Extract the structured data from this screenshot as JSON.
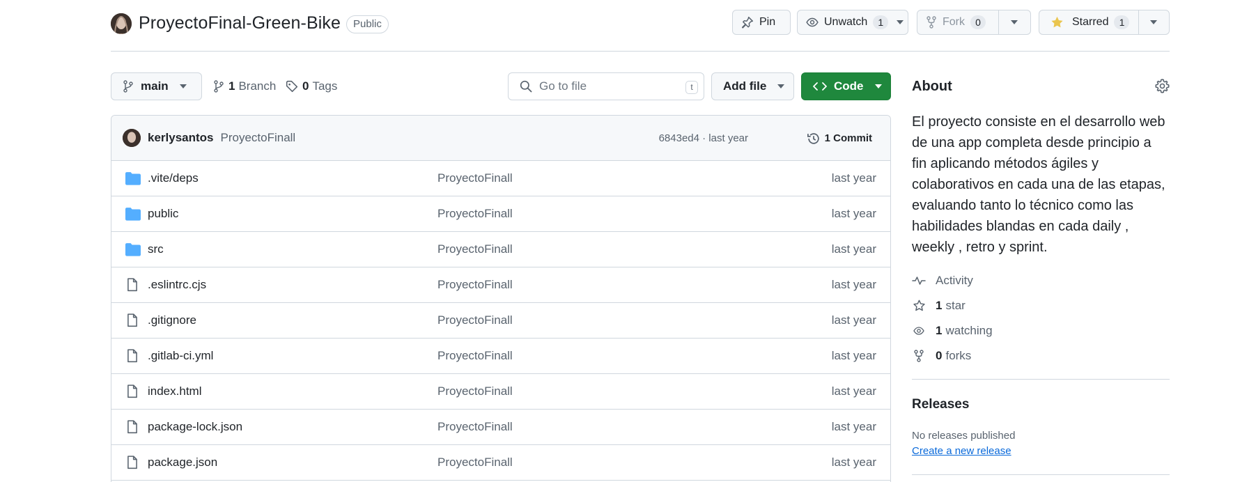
{
  "header": {
    "repo_name": "ProyectoFinal-Green-Bike",
    "visibility": "Public",
    "pin_label": "Pin",
    "watch_label": "Unwatch",
    "watch_count": "1",
    "fork_label": "Fork",
    "fork_count": "0",
    "star_label": "Starred",
    "star_count": "1"
  },
  "toolbar": {
    "branch": "main",
    "branch_count": "1",
    "branch_label": "Branch",
    "tag_count": "0",
    "tag_label": "Tags",
    "search_placeholder": "Go to file",
    "search_shortcut": "t",
    "add_file_label": "Add file",
    "code_label": "Code"
  },
  "commit": {
    "author": "kerlysantos",
    "message": "ProyectoFinall",
    "hash_age": "6843ed4 · last year",
    "count_label": "1 Commit"
  },
  "files": [
    {
      "name": ".vite/deps",
      "type": "folder",
      "message": "ProyectoFinall",
      "age": "last year"
    },
    {
      "name": "public",
      "type": "folder",
      "message": "ProyectoFinall",
      "age": "last year"
    },
    {
      "name": "src",
      "type": "folder",
      "message": "ProyectoFinall",
      "age": "last year"
    },
    {
      "name": ".eslintrc.cjs",
      "type": "file",
      "message": "ProyectoFinall",
      "age": "last year"
    },
    {
      "name": ".gitignore",
      "type": "file",
      "message": "ProyectoFinall",
      "age": "last year"
    },
    {
      "name": ".gitlab-ci.yml",
      "type": "file",
      "message": "ProyectoFinall",
      "age": "last year"
    },
    {
      "name": "index.html",
      "type": "file",
      "message": "ProyectoFinall",
      "age": "last year"
    },
    {
      "name": "package-lock.json",
      "type": "file",
      "message": "ProyectoFinall",
      "age": "last year"
    },
    {
      "name": "package.json",
      "type": "file",
      "message": "ProyectoFinall",
      "age": "last year"
    }
  ],
  "about": {
    "title": "About",
    "description": "El proyecto consiste en el desarrollo web de una app completa desde principio a fin aplicando métodos ágiles y colaborativos en cada una de las etapas, evaluando tanto lo técnico como las habilidades blandas en cada daily , weekly , retro y sprint.",
    "activity_label": "Activity",
    "stars_count": "1",
    "stars_label": "star",
    "watching_count": "1",
    "watching_label": "watching",
    "forks_count": "0",
    "forks_label": "forks"
  },
  "releases": {
    "title": "Releases",
    "empty_text": "No releases published",
    "create_link": "Create a new release"
  },
  "colors": {
    "code_button": "#1f883d",
    "folder_icon": "#54aeff",
    "link": "#0969da",
    "star": "#eac54f"
  }
}
